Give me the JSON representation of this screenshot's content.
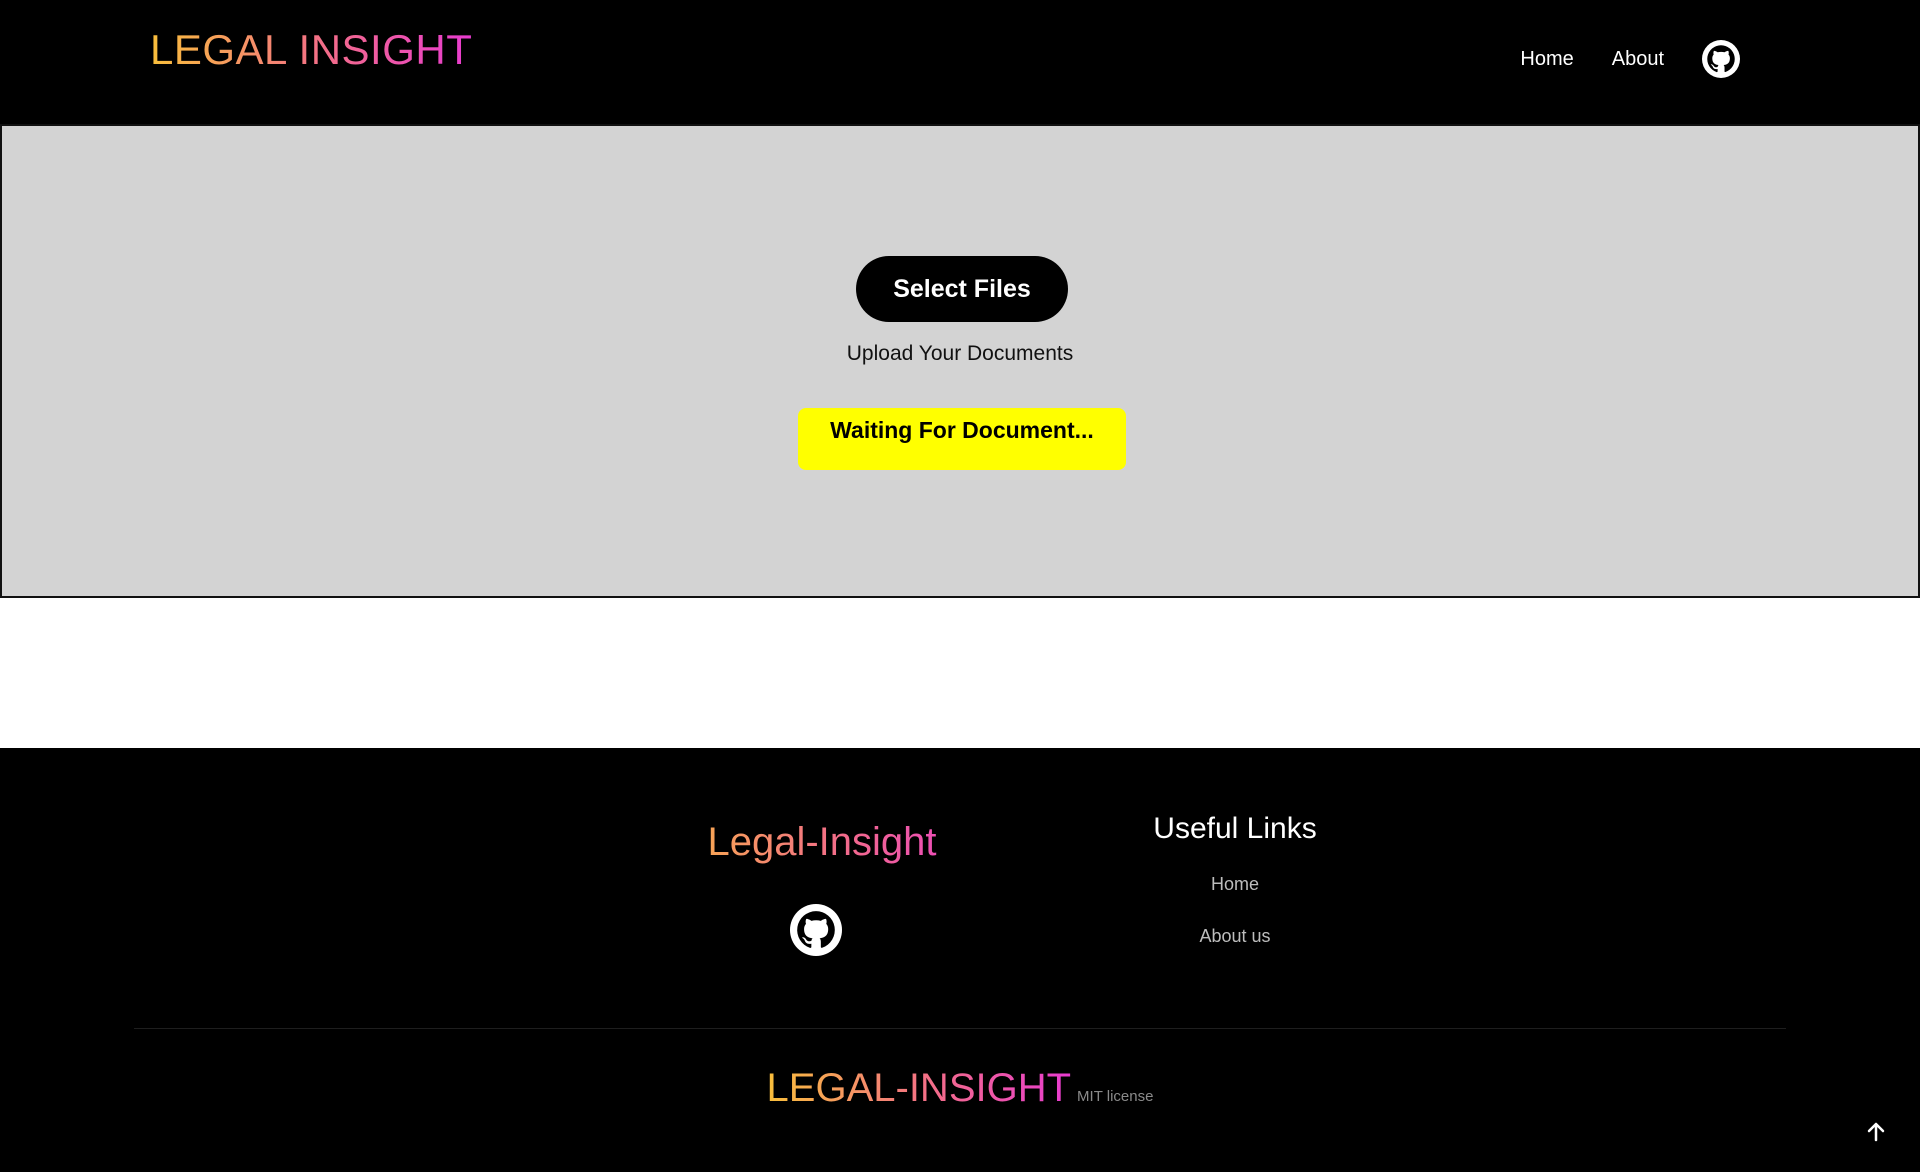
{
  "header": {
    "brand": "LEGAL INSIGHT",
    "nav": {
      "home": "Home",
      "about": "About"
    },
    "github_icon": "github-icon"
  },
  "upload": {
    "select_button": "Select Files",
    "hint": "Upload Your Documents",
    "status": "Waiting For Document..."
  },
  "footer": {
    "brand": "Legal-Insight",
    "github_icon": "github-icon",
    "links_title": "Useful Links",
    "links": {
      "home": "Home",
      "about": "About us"
    },
    "bottom_brand": "LEGAL-INSIGHT",
    "license": "MIT license",
    "scroll_top_icon": "arrow-up-icon"
  },
  "colors": {
    "header_bg": "#000000",
    "upload_bg": "#d3d3d3",
    "status_bg": "#ffff00",
    "gradient_start": "#f9bf3b",
    "gradient_mid": "#f36c8a",
    "gradient_end": "#e83bd0"
  }
}
